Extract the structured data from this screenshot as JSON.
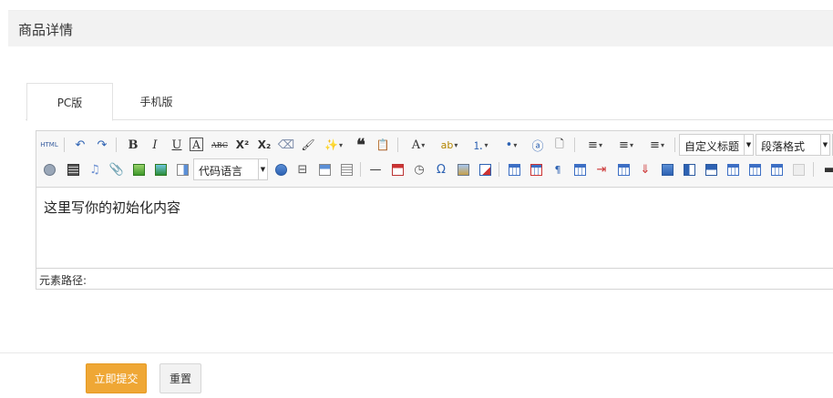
{
  "panel": {
    "title": "商品详情"
  },
  "tabs": [
    {
      "label": "PC版",
      "active": true
    },
    {
      "label": "手机版",
      "active": false
    }
  ],
  "editor": {
    "toolbar": {
      "row1": [
        {
          "name": "source-html",
          "glyph": "HTML"
        },
        {
          "name": "undo",
          "glyph": "↶"
        },
        {
          "name": "redo",
          "glyph": "↷"
        },
        {
          "name": "bold",
          "glyph": "B"
        },
        {
          "name": "italic",
          "glyph": "I"
        },
        {
          "name": "underline",
          "glyph": "U"
        },
        {
          "name": "font-border",
          "glyph": "A"
        },
        {
          "name": "strikethrough",
          "glyph": "ABC"
        },
        {
          "name": "superscript",
          "glyph": "X²"
        },
        {
          "name": "subscript",
          "glyph": "X₂"
        },
        {
          "name": "eraser",
          "glyph": "⌫"
        },
        {
          "name": "format-brush",
          "glyph": "🖌"
        },
        {
          "name": "autotypeset",
          "glyph": "✨"
        },
        {
          "name": "blockquote",
          "glyph": "❝"
        },
        {
          "name": "paste-plain",
          "glyph": "📋"
        },
        {
          "name": "forecolor",
          "glyph": "A"
        },
        {
          "name": "backcolor",
          "glyph": "ab"
        },
        {
          "name": "ordered-list",
          "glyph": "⒈"
        },
        {
          "name": "unordered-list",
          "glyph": "•"
        },
        {
          "name": "select-all",
          "glyph": "ⓐ"
        },
        {
          "name": "clear-doc",
          "glyph": "🗋"
        },
        {
          "name": "row-spacing-top",
          "glyph": "≡"
        },
        {
          "name": "row-spacing-bottom",
          "glyph": "≡"
        },
        {
          "name": "line-height",
          "glyph": "≡"
        }
      ],
      "custom_heading": "自定义标题",
      "paragraph_format": "段落格式",
      "code_language": "代码语言"
    },
    "content_text": "这里写你的初始化内容",
    "element_path_label": "元素路径:"
  },
  "footer": {
    "submit_label": "立即提交",
    "reset_label": "重置"
  },
  "colors": {
    "accent": "#efa735",
    "header_bg": "#f2f2f2",
    "toolbar_bg": "#f7f7f7"
  }
}
